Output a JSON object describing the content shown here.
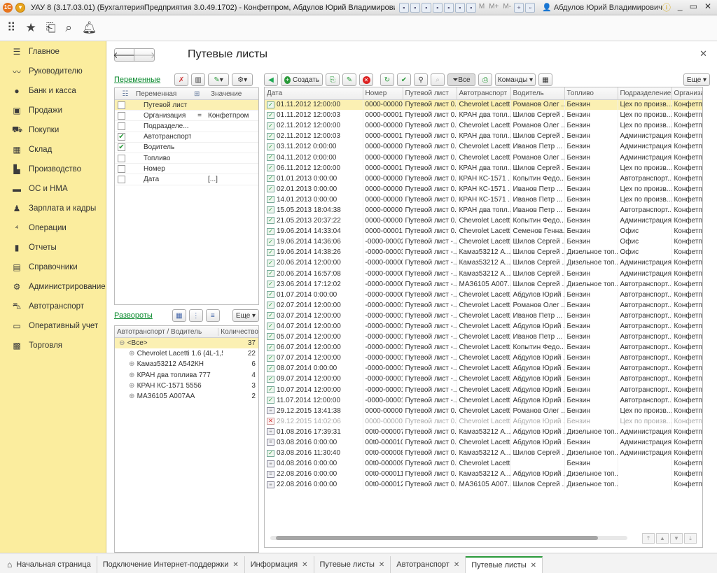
{
  "titlebar": {
    "title": "УАУ 8 (3.17.03.01) (БухгалтерияПредприятия 3.0.49.1702) - Конфетпром, Абдулов Юрий Владимирович  (1С:Предприятие)",
    "user": "Абдулов Юрий Владимирович",
    "mem_labels": [
      "M",
      "M+",
      "M-"
    ]
  },
  "sidebar": {
    "items": [
      {
        "label": "Главное",
        "icon": "menu-icon"
      },
      {
        "label": "Руководителю",
        "icon": "chart-line-icon"
      },
      {
        "label": "Банк и касса",
        "icon": "coin-icon"
      },
      {
        "label": "Продажи",
        "icon": "bag-icon"
      },
      {
        "label": "Покупки",
        "icon": "cart-icon"
      },
      {
        "label": "Склад",
        "icon": "warehouse-icon"
      },
      {
        "label": "Производство",
        "icon": "factory-icon"
      },
      {
        "label": "ОС и НМА",
        "icon": "truck-icon"
      },
      {
        "label": "Зарплата и кадры",
        "icon": "person-icon"
      },
      {
        "label": "Операции",
        "icon": "operations-icon"
      },
      {
        "label": "Отчеты",
        "icon": "bar-chart-icon"
      },
      {
        "label": "Справочники",
        "icon": "book-icon"
      },
      {
        "label": "Администрирование",
        "icon": "gear-icon"
      },
      {
        "label": "Автотранспорт",
        "icon": "car-icon"
      },
      {
        "label": "Оперативный учет",
        "icon": "monitor-icon"
      },
      {
        "label": "Торговля",
        "icon": "register-icon"
      }
    ]
  },
  "page": {
    "title": "Путевые листы"
  },
  "variables": {
    "link": "Переменные",
    "columns": [
      "Переменная",
      "Значение"
    ],
    "rows": [
      {
        "checked": false,
        "name": "Путевой лист",
        "op": "",
        "value": "",
        "selected": true
      },
      {
        "checked": false,
        "name": "Организация",
        "op": "=",
        "value": "Конфетпром",
        "selected": false
      },
      {
        "checked": false,
        "name": "Подразделе...",
        "op": "",
        "value": "",
        "selected": false
      },
      {
        "checked": true,
        "name": "Автотранспорт",
        "op": "",
        "value": "",
        "selected": false
      },
      {
        "checked": true,
        "name": "Водитель",
        "op": "",
        "value": "",
        "selected": false
      },
      {
        "checked": false,
        "name": "Топливо",
        "op": "",
        "value": "",
        "selected": false
      },
      {
        "checked": false,
        "name": "Номер",
        "op": "",
        "value": "",
        "selected": false
      },
      {
        "checked": false,
        "name": "Дата",
        "op": "",
        "value": "[...]",
        "selected": false
      }
    ]
  },
  "razvoroty": {
    "link": "Развороты",
    "more_label": "Еще",
    "columns": [
      "Автотранспорт / Водитель",
      "Количество"
    ],
    "rows": [
      {
        "label": "<Все>",
        "count": "37",
        "level": 0,
        "selected": true
      },
      {
        "label": "Chevrolet Lacetti 1.6 (4L-1,5...",
        "count": "22",
        "level": 1,
        "selected": false
      },
      {
        "label": "Камаз53212 А542КН",
        "count": "6",
        "level": 1,
        "selected": false
      },
      {
        "label": "КРАН два топлива 777",
        "count": "4",
        "level": 1,
        "selected": false
      },
      {
        "label": "КРАН КС-1571 5556",
        "count": "3",
        "level": 1,
        "selected": false
      },
      {
        "label": "МАЗ6105 А007АА",
        "count": "2",
        "level": 1,
        "selected": false
      }
    ]
  },
  "toolbar": {
    "create_label": "Создать",
    "all_label": "Все",
    "commands_label": "Команды",
    "more_label": "Еще"
  },
  "docs": {
    "columns": [
      "Дата",
      "Номер",
      "Путевой лист",
      "Автотранспорт",
      "Водитель",
      "Топливо",
      "Подразделение",
      "Организа"
    ],
    "rows": [
      {
        "state": "post",
        "sel": true,
        "c": [
          "01.11.2012 12:00:00",
          "0000-000001",
          "Путевой лист 0...",
          "Chevrolet Lacett...",
          "Романов Олег ...",
          "Бензин",
          "Цех по произв...",
          "Конфетпр"
        ]
      },
      {
        "state": "post",
        "c": [
          "01.11.2012 12:00:03",
          "0000-000011",
          "Путевой лист 0...",
          "КРАН два топл...",
          "Шилов Сергей ...",
          "Бензин",
          "Цех по произв...",
          "Конфетпр"
        ]
      },
      {
        "state": "post",
        "c": [
          "02.11.2012 12:00:00",
          "0000-000002",
          "Путевой лист 0...",
          "Chevrolet Lacett...",
          "Романов Олег ...",
          "Бензин",
          "Цех по произв...",
          "Конфетпр"
        ]
      },
      {
        "state": "post",
        "c": [
          "02.11.2012 12:00:03",
          "0000-000012",
          "Путевой лист 0...",
          "КРАН два топл...",
          "Шилов Сергей ...",
          "Бензин",
          "Администрация",
          "Конфетпр"
        ]
      },
      {
        "state": "post",
        "c": [
          "03.11.2012 0:00:00",
          "0000-000003",
          "Путевой лист 0...",
          "Chevrolet Lacett...",
          "Иванов Петр ...",
          "Бензин",
          "Администрация",
          "Конфетпр"
        ]
      },
      {
        "state": "post",
        "c": [
          "04.11.2012 0:00:00",
          "0000-000004",
          "Путевой лист 0...",
          "Chevrolet Lacett...",
          "Романов Олег ...",
          "Бензин",
          "Администрация",
          "Конфетпр"
        ]
      },
      {
        "state": "post",
        "c": [
          "06.11.2012 12:00:00",
          "0000-000015",
          "Путевой лист 0...",
          "КРАН два топл...",
          "Шилов Сергей ...",
          "Бензин",
          "Цех по произв...",
          "Конфетпр"
        ]
      },
      {
        "state": "post",
        "c": [
          "01.01.2013 0:00:00",
          "0000-000002",
          "Путевой лист 0...",
          "КРАН КС-1571 ...",
          "Копытин Федо...",
          "Бензин",
          "Автотранспорт...",
          "Конфетпр"
        ]
      },
      {
        "state": "post",
        "c": [
          "02.01.2013 0:00:00",
          "0000-000001",
          "Путевой лист 0...",
          "КРАН КС-1571 ...",
          "Иванов Петр ...",
          "Бензин",
          "Цех по произв...",
          "Конфетпр"
        ]
      },
      {
        "state": "post",
        "c": [
          "14.01.2013 0:00:00",
          "0000-000003",
          "Путевой лист 0...",
          "КРАН КС-1571 ...",
          "Иванов Петр ...",
          "Бензин",
          "Цех по произв...",
          "Конфетпр"
        ]
      },
      {
        "state": "post",
        "c": [
          "15.05.2013 18:04:38",
          "0000-000007",
          "Путевой лист 0...",
          "КРАН два топл...",
          "Иванов Петр ...",
          "Бензин",
          "Автотранспорт...",
          "Конфетпр"
        ]
      },
      {
        "state": "post",
        "c": [
          "21.05.2013 20:37:22",
          "0000-000009",
          "Путевой лист 0...",
          "Chevrolet Lacett...",
          "Копытин Федо...",
          "Бензин",
          "Администрация",
          "Конфетпр"
        ]
      },
      {
        "state": "post",
        "c": [
          "19.06.2014 14:33:04",
          "0000-00001",
          "Путевой лист 0...",
          "Chevrolet Lacett...",
          "Семенов Генна...",
          "Бензин",
          "Офис",
          "Конфетпр"
        ]
      },
      {
        "state": "post",
        "c": [
          "19.06.2014 14:36:06",
          "-0000-00002",
          "Путевой лист -...",
          "Chevrolet Lacett...",
          "Шилов Сергей ...",
          "Бензин",
          "Офис",
          "Конфетпр"
        ]
      },
      {
        "state": "post",
        "c": [
          "19.06.2014 14:38:26",
          "-0000-00003",
          "Путевой лист -...",
          "Камаз53212 А...",
          "Шилов Сергей ...",
          "Дизельное топ...",
          "Офис",
          "Конфетпр"
        ]
      },
      {
        "state": "post",
        "c": [
          "20.06.2014 12:00:00",
          "-0000-000004",
          "Путевой лист -...",
          "Камаз53212 А...",
          "Шилов Сергей ...",
          "Дизельное топ...",
          "Администрация",
          "Конфетпр"
        ]
      },
      {
        "state": "post",
        "c": [
          "20.06.2014 16:57:08",
          "-0000-000005",
          "Путевой лист -...",
          "Камаз53212 А...",
          "Шилов Сергей ...",
          "Бензин",
          "Администрация",
          "Конфетпр"
        ]
      },
      {
        "state": "post",
        "c": [
          "23.06.2014 17:12:02",
          "-0000-000008",
          "Путевой лист -...",
          "МАЗ6105 А007...",
          "Шилов Сергей ...",
          "Дизельное топ...",
          "Автотранспорт...",
          "Конфетпр"
        ]
      },
      {
        "state": "post",
        "c": [
          "01.07.2014 0:00:00",
          "-0000-000009",
          "Путевой лист -...",
          "Chevrolet Lacett...",
          "Абдулов Юрий ...",
          "Бензин",
          "Автотранспорт...",
          "Конфетпр"
        ]
      },
      {
        "state": "post",
        "c": [
          "02.07.2014 12:00:00",
          "-0000-000010",
          "Путевой лист -...",
          "Chevrolet Lacett...",
          "Романов Олег ...",
          "Бензин",
          "Автотранспорт...",
          "Конфетпр"
        ]
      },
      {
        "state": "post",
        "c": [
          "03.07.2014 12:00:00",
          "-0000-000011",
          "Путевой лист -...",
          "Chevrolet Lacett...",
          "Иванов Петр ...",
          "Бензин",
          "Автотранспорт...",
          "Конфетпр"
        ]
      },
      {
        "state": "post",
        "c": [
          "04.07.2014 12:00:00",
          "-0000-000012",
          "Путевой лист -...",
          "Chevrolet Lacett...",
          "Абдулов Юрий ...",
          "Бензин",
          "Автотранспорт...",
          "Конфетпр"
        ]
      },
      {
        "state": "post",
        "c": [
          "05.07.2014 12:00:00",
          "-0000-000013",
          "Путевой лист -...",
          "Chevrolet Lacett...",
          "Иванов Петр ...",
          "Бензин",
          "Автотранспорт...",
          "Конфетпр"
        ]
      },
      {
        "state": "post",
        "c": [
          "06.07.2014 12:00:00",
          "-0000-000014",
          "Путевой лист -...",
          "Chevrolet Lacett...",
          "Копытин Федо...",
          "Бензин",
          "Автотранспорт...",
          "Конфетпр"
        ]
      },
      {
        "state": "post",
        "c": [
          "07.07.2014 12:00:00",
          "-0000-000015",
          "Путевой лист -...",
          "Chevrolet Lacett...",
          "Абдулов Юрий ...",
          "Бензин",
          "Автотранспорт...",
          "Конфетпр"
        ]
      },
      {
        "state": "post",
        "c": [
          "08.07.2014 0:00:00",
          "-0000-000016",
          "Путевой лист -...",
          "Chevrolet Lacett...",
          "Абдулов Юрий ...",
          "Бензин",
          "Автотранспорт...",
          "Конфетпр"
        ]
      },
      {
        "state": "post",
        "c": [
          "09.07.2014 12:00:00",
          "-0000-000017",
          "Путевой лист -...",
          "Chevrolet Lacett...",
          "Абдулов Юрий ...",
          "Бензин",
          "Автотранспорт...",
          "Конфетпр"
        ]
      },
      {
        "state": "post",
        "c": [
          "10.07.2014 12:00:00",
          "-0000-000018",
          "Путевой лист -...",
          "Chevrolet Lacett...",
          "Абдулов Юрий ...",
          "Бензин",
          "Автотранспорт...",
          "Конфетпр"
        ]
      },
      {
        "state": "post",
        "c": [
          "11.07.2014 12:00:00",
          "-0000-000019",
          "Путевой лист -...",
          "Chevrolet Lacett...",
          "Абдулов Юрий ...",
          "Бензин",
          "Автотранспорт...",
          "Конфетпр"
        ]
      },
      {
        "state": "plain",
        "c": [
          "29.12.2015 13:41:38",
          "0000-000004",
          "Путевой лист 0...",
          "Chevrolet Lacett...",
          "Романов Олег ...",
          "Бензин",
          "Цех по произв...",
          "Конфетпр"
        ]
      },
      {
        "state": "del",
        "grey": true,
        "c": [
          "29.12.2015 14:02:06",
          "0000-000005",
          "Путевой лист 0...",
          "Chevrolet Lacett...",
          "Абдулов Юрий ...",
          "Бензин",
          "Цех по произв...",
          "Конфетпр"
        ]
      },
      {
        "state": "plain",
        "c": [
          "01.08.2016 17:39:31",
          "00t0-000007",
          "Путевой лист 0...",
          "Камаз53212 А...",
          "Абдулов Юрий ...",
          "Дизельное топ...",
          "Администрация",
          "Конфетпр"
        ]
      },
      {
        "state": "plain",
        "c": [
          "03.08.2016 0:00:00",
          "00t0-000010",
          "Путевой лист 0...",
          "Chevrolet Lacett...",
          "Абдулов Юрий ...",
          "Бензин",
          "Администрация",
          "Конфетпр"
        ]
      },
      {
        "state": "post",
        "c": [
          "03.08.2016 11:30:40",
          "00t0-000008",
          "Путевой лист 0...",
          "Камаз53212 А...",
          "Шилов Сергей ...",
          "Дизельное топ...",
          "Администрация",
          "Конфетпр"
        ]
      },
      {
        "state": "plain",
        "c": [
          "04.08.2016 0:00:00",
          "00t0-000009",
          "Путевой лист 0...",
          "Chevrolet Lacett...",
          "",
          "Бензин",
          "",
          "Конфетпр"
        ]
      },
      {
        "state": "plain",
        "c": [
          "22.08.2016 0:00:00",
          "00t0-000011",
          "Путевой лист 0...",
          "Камаз53212 А...",
          "Абдулов Юрий ...",
          "Дизельное топ...",
          "",
          "Конфетпр"
        ]
      },
      {
        "state": "plain",
        "c": [
          "22.08.2016 0:00:00",
          "00t0-000012",
          "Путевой лист 0...",
          "МАЗ6105 А007...",
          "Шилов Сергей ...",
          "Дизельное топ...",
          "",
          "Конфетпр"
        ]
      }
    ]
  },
  "tabs": [
    {
      "label": "Начальная страница",
      "home": true,
      "closable": false
    },
    {
      "label": "Подключение Интернет-поддержки",
      "closable": true
    },
    {
      "label": "Информация",
      "closable": true
    },
    {
      "label": "Путевые листы",
      "closable": true
    },
    {
      "label": "Автотранспорт",
      "closable": true
    },
    {
      "label": "Путевые листы",
      "closable": true,
      "active": true
    }
  ]
}
